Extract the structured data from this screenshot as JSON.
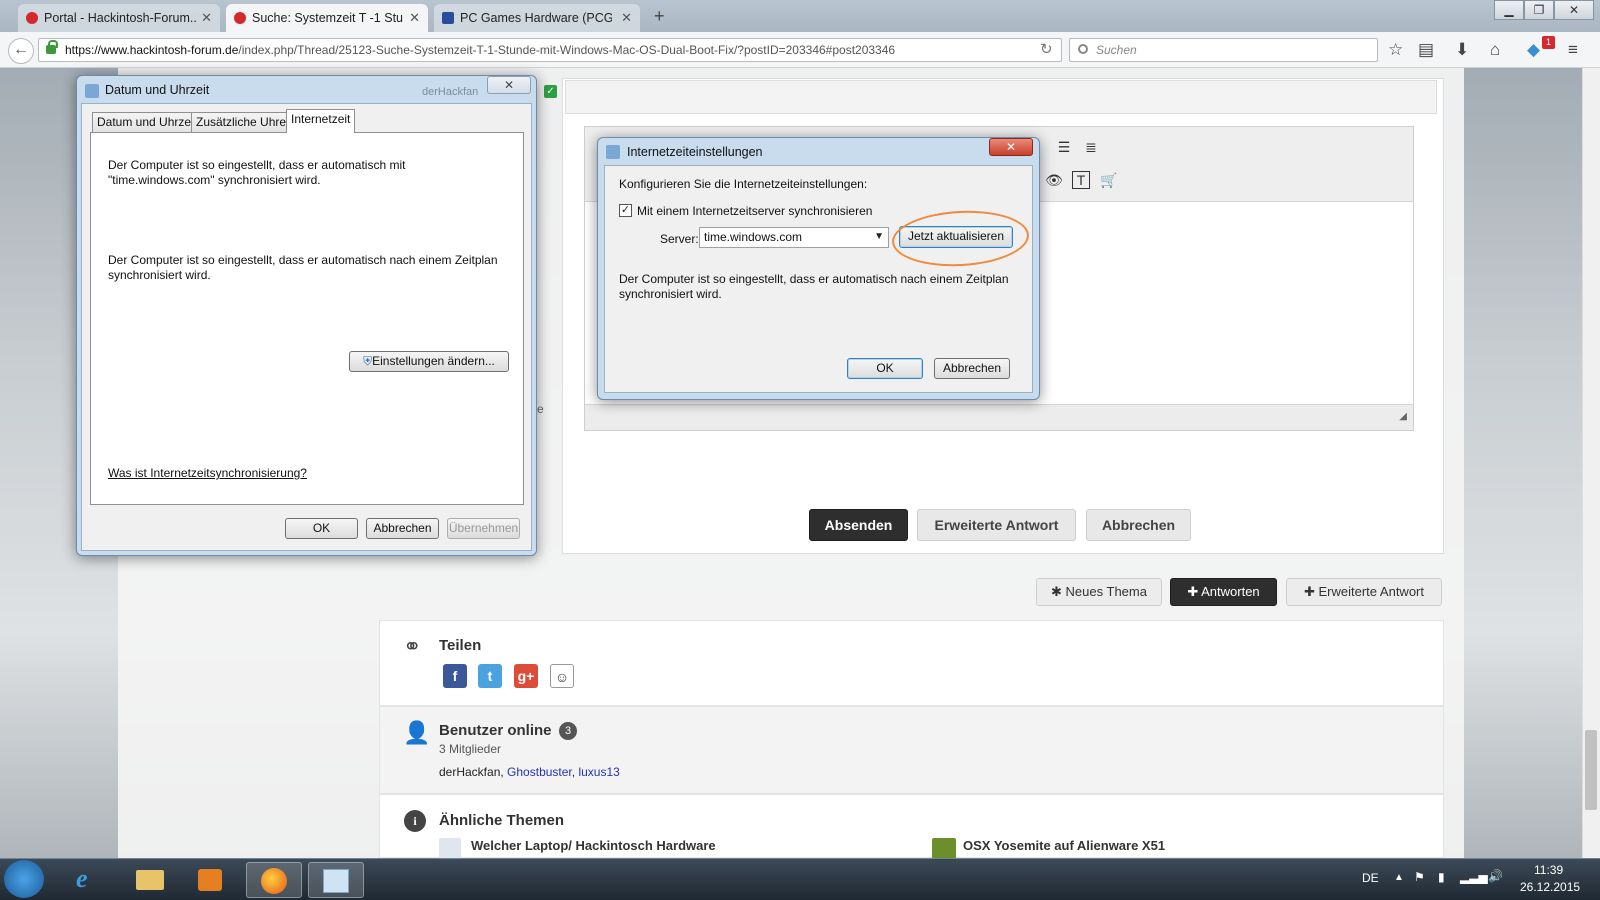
{
  "browser": {
    "tabs": [
      {
        "label": "Portal - Hackintosh-Forum...",
        "active": false
      },
      {
        "label": "Suche: Systemzeit T -1 Stu...",
        "active": true
      },
      {
        "label": "PC Games Hardware (PCG...",
        "active": false
      }
    ],
    "url_host": "https://www.hackintosh-forum.de",
    "url_path": "/index.php/Thread/25123-Suche-Systemzeit-T-1-Stunde-mit-Windows-Mac-OS-Dual-Boot-Fix/?postID=203346#post203346",
    "search_placeholder": "Suchen",
    "notification_count": "1"
  },
  "editor": {
    "submit_label": "Absenden",
    "extended_label": "Erweiterte Antwort",
    "cancel_label": "Abbrechen",
    "side_letter": "e"
  },
  "thread_actions": {
    "new_topic": "Neues Thema",
    "reply": "Antworten",
    "extended_reply": "Erweiterte Antwort"
  },
  "share": {
    "title": "Teilen"
  },
  "online": {
    "title": "Benutzer online",
    "count": "3",
    "members_label": "3 Mitglieder",
    "users": [
      "derHackfan",
      "Ghostbuster",
      "luxus13"
    ]
  },
  "similar": {
    "title": "Ähnliche Themen",
    "items": [
      "Welcher Laptop/ Hackintosch Hardware",
      "OSX Yosemite auf Alienware X51"
    ]
  },
  "datetime_dialog": {
    "title": "Datum und Uhrzeit",
    "tabs": [
      "Datum und Uhrzeit",
      "Zusätzliche Uhren",
      "Internetzeit"
    ],
    "text1": "Der Computer ist so eingestellt, dass er automatisch mit \"time.windows.com\" synchronisiert wird.",
    "text2": "Der Computer ist so eingestellt, dass er automatisch nach einem Zeitplan synchronisiert wird.",
    "change_settings": "Einstellungen ändern...",
    "help_link": "Was ist Internetzeitsynchronisierung?",
    "ok": "OK",
    "cancel": "Abbrechen",
    "apply": "Übernehmen",
    "obscured_text": "derHackfan"
  },
  "inet_dialog": {
    "title": "Internetzeiteinstellungen",
    "heading": "Konfigurieren Sie die Internetzeiteinstellungen:",
    "checkbox_label": "Mit einem Internetzeitserver synchronisieren",
    "checked": true,
    "server_label": "Server:",
    "server_value": "time.windows.com",
    "update_now": "Jetzt aktualisieren",
    "info": "Der Computer ist so eingestellt, dass er automatisch nach einem Zeitplan synchronisiert wird.",
    "ok": "OK",
    "cancel": "Abbrechen",
    "highlight_color": "#f08a3c"
  },
  "taskbar": {
    "lang": "DE",
    "time": "11:39",
    "date": "26.12.2015"
  }
}
